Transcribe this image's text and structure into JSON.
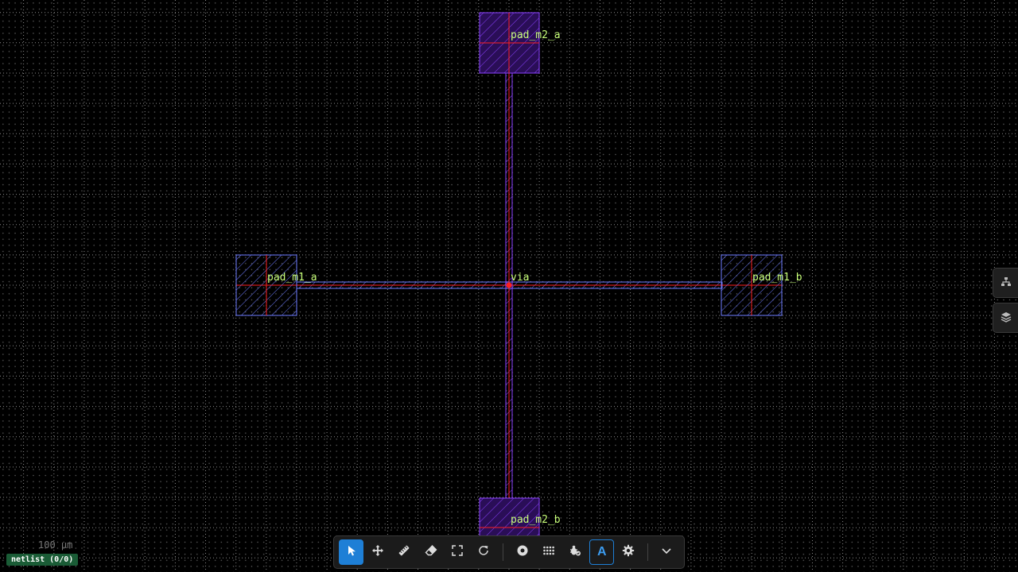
{
  "labels": {
    "pad_m2_a": "pad_m2_a",
    "pad_m2_b": "pad_m2_b",
    "pad_m1_a": "pad_m1_a",
    "pad_m1_b": "pad_m1_b",
    "via": "via"
  },
  "scale_label": "100 µm",
  "netlist_badge": "netlist (0/0)",
  "toolbar": {
    "tools": [
      {
        "name": "select-tool-button",
        "icon": "cursor-icon",
        "state": "active"
      },
      {
        "name": "pan-tool-button",
        "icon": "move-icon"
      },
      {
        "name": "measure-tool-button",
        "icon": "ruler-icon"
      },
      {
        "name": "erase-tool-button",
        "icon": "eraser-icon"
      },
      {
        "name": "fit-view-button",
        "icon": "fullscreen-icon"
      },
      {
        "name": "rotate-button",
        "icon": "rotate-icon"
      },
      {
        "name": "via-tool-button",
        "icon": "circle-dot-icon"
      },
      {
        "name": "grid-toggle-button",
        "icon": "grid-icon"
      },
      {
        "name": "drc-button",
        "icon": "bug-check-icon"
      },
      {
        "name": "text-label-toggle-button",
        "icon": "text-a-icon",
        "state": "toggled"
      },
      {
        "name": "settings-button",
        "icon": "gear-icon"
      },
      {
        "name": "expand-toolbar-button",
        "icon": "chevron-down-icon"
      }
    ],
    "text_label_glyph": "A"
  },
  "side_panel": {
    "buttons": [
      {
        "name": "hierarchy-panel-button",
        "icon": "hierarchy-icon"
      },
      {
        "name": "layers-panel-button",
        "icon": "layers-icon"
      }
    ]
  },
  "colors": {
    "background": "#000000",
    "m1_outline": "#6e7cff",
    "m2_outline": "#7d2cff",
    "m2_fill": "#2a0e57",
    "net_red": "#ff2020",
    "label_text": "#c8ff7a",
    "accent_blue": "#1e7fd6",
    "badge_green": "#1a5c36"
  }
}
